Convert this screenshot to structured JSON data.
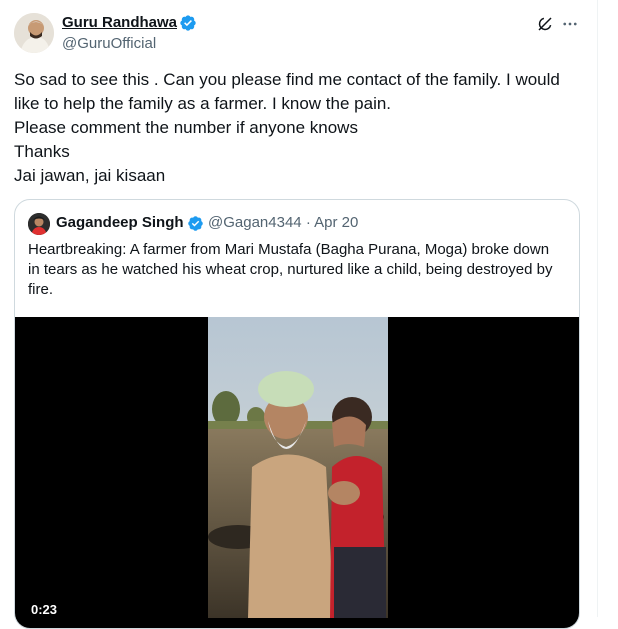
{
  "author": {
    "display_name": "Guru Randhawa",
    "handle": "@GuruOfficial"
  },
  "tweet": {
    "lines": [
      "So sad to see this . Can you please find me contact of the family. I would",
      "like to help the family as a farmer. I know the pain.",
      "Please comment the number if anyone knows",
      "Thanks",
      "Jai jawan, jai kisaan"
    ]
  },
  "quoted": {
    "display_name": "Gagandeep Singh",
    "handle": "@Gagan4344",
    "separator": "·",
    "date": "Apr 20",
    "lines": [
      "Heartbreaking: A farmer from Mari Mustafa (Bagha Purana, Moga) broke down",
      "in tears as he watched his wheat crop, nurtured like a child, being destroyed by",
      "fire."
    ],
    "video": {
      "duration": "0:23"
    }
  },
  "icons": {
    "verified": "verified-badge-icon",
    "grok": "grok-icon",
    "more": "more-dots-icon"
  },
  "colors": {
    "verified": "#1d9bf0",
    "text": "#0f1419",
    "secondary": "#536471",
    "border": "#cfd9de"
  }
}
